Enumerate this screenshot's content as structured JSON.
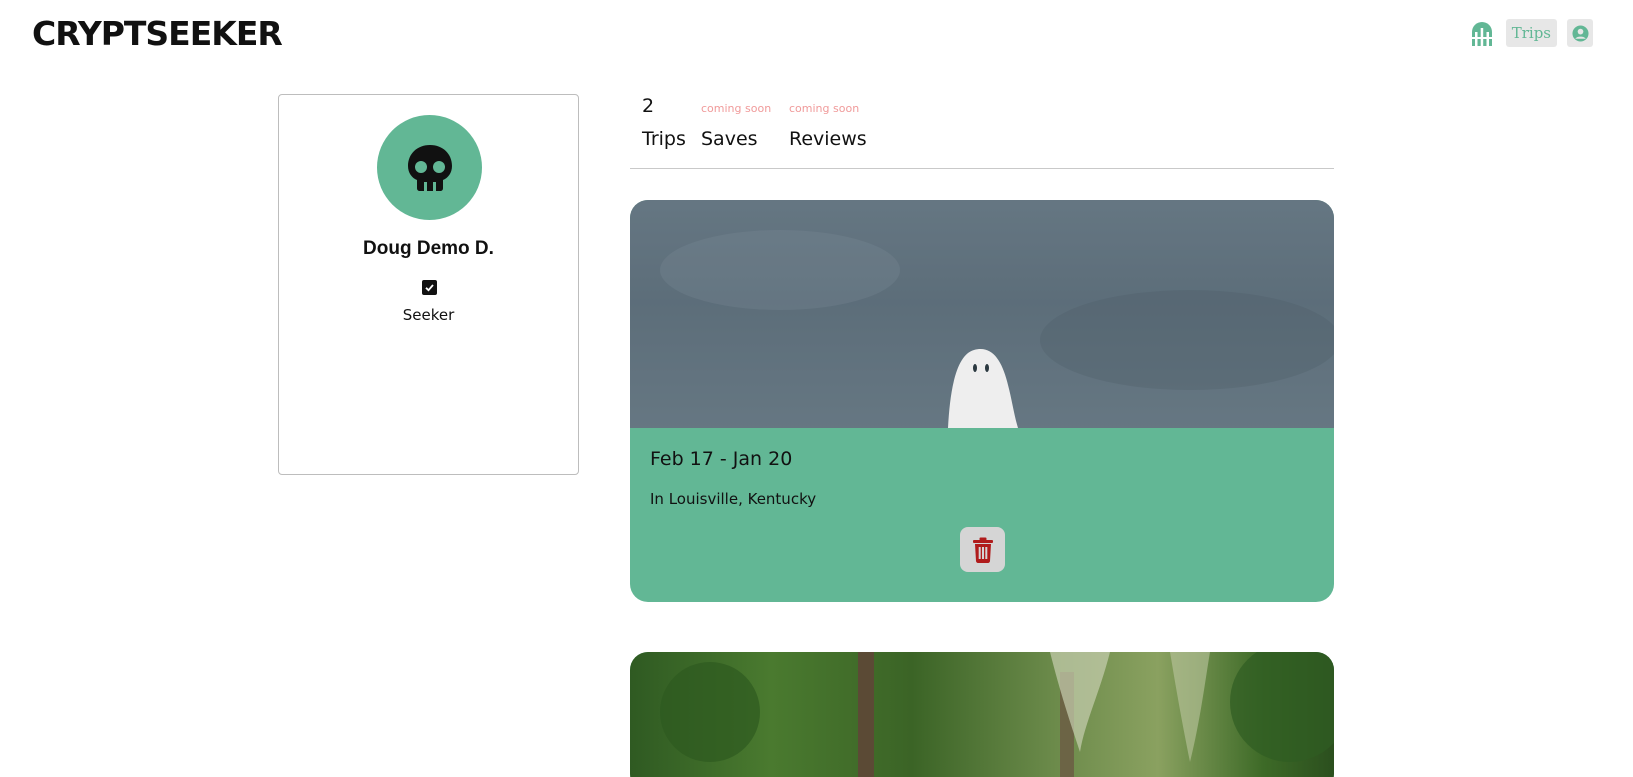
{
  "header": {
    "logo_text": "CRYPTSEEKER",
    "nav": {
      "home_icon": "crypt-gate-icon",
      "trips_label": "Trips",
      "profile_icon": "user-circle-icon"
    },
    "accent_color": "#62b795"
  },
  "profile": {
    "avatar_icon": "skull-icon",
    "name": "Doug Demo D.",
    "verified_icon": "checkbox-checked-icon",
    "role": "Seeker"
  },
  "stats": {
    "trips": {
      "value": "2",
      "label": "Trips"
    },
    "saves": {
      "note": "coming soon",
      "label": "Saves"
    },
    "reviews": {
      "note": "coming soon",
      "label": "Reviews"
    }
  },
  "trips": [
    {
      "image": "ghost-sheet-photo",
      "dates": "Feb 17 - Jan 20",
      "location": "In Louisville, Kentucky",
      "delete_icon": "trash-icon"
    },
    {
      "image": "forest-moss-photo"
    }
  ]
}
